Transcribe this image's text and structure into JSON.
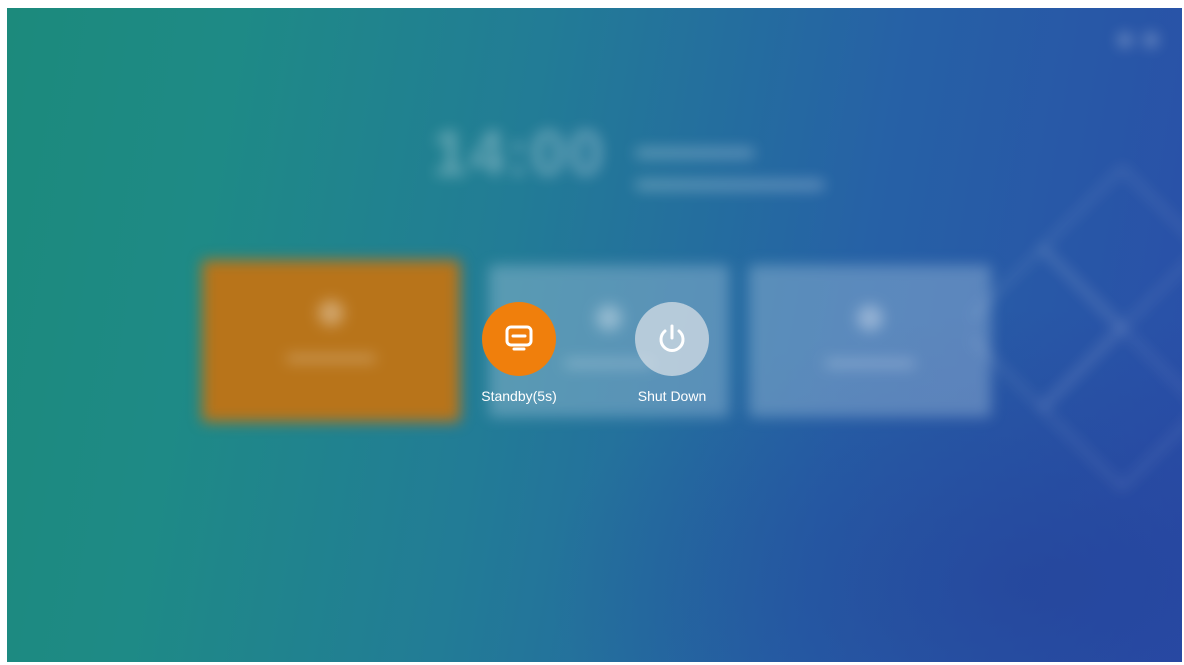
{
  "background": {
    "clock_text": "14:00",
    "colors": {
      "gradient_start": "#1c8a7c",
      "gradient_end": "#2a4ea8",
      "highlight_card": "#b8741a"
    }
  },
  "power_menu": {
    "options": [
      {
        "label": "Standby(5s)",
        "icon": "tv-standby-icon",
        "color": "#f07f0c",
        "selected": true
      },
      {
        "label": "Shut Down",
        "icon": "power-icon",
        "color": "#dae0e8",
        "selected": false
      }
    ]
  }
}
